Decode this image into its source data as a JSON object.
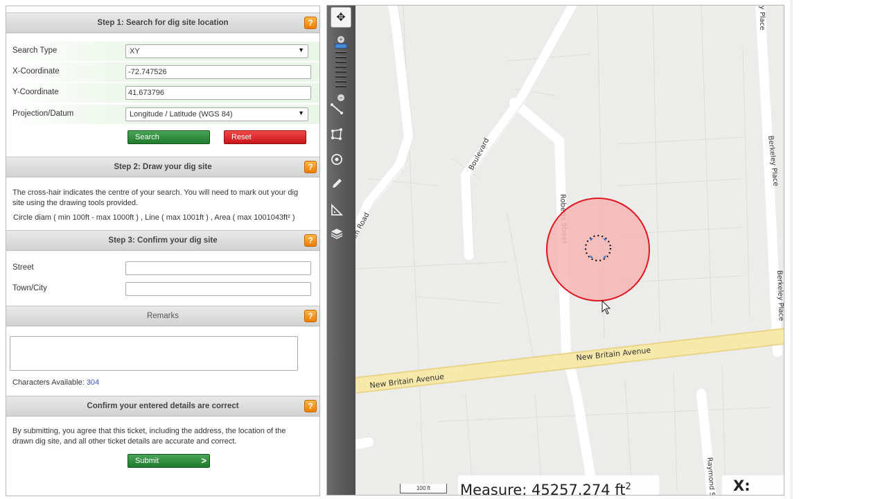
{
  "form": {
    "step1": {
      "title": "Step 1: Search for dig site location",
      "help": "?",
      "fields": [
        {
          "label": "Search Type",
          "value": "XY",
          "kind": "select"
        },
        {
          "label": "X-Coordinate",
          "value": "-72.747526",
          "kind": "input"
        },
        {
          "label": "Y-Coordinate",
          "value": "41.673796",
          "kind": "input"
        },
        {
          "label": "Projection/Datum",
          "value": "Longitude / Latitude (WGS 84)",
          "kind": "select"
        }
      ],
      "search_label": "Search",
      "reset_label": "Reset"
    },
    "step2": {
      "title": "Step 2: Draw your dig site",
      "help": "?",
      "instructions_line1": "The cross-hair indicates the centre of your search. You will need to mark out your dig",
      "instructions_line2": "site using the drawing tools provided.",
      "limits": "Circle diam ( min 100ft - max 1000ft ) , Line ( max 1001ft ) , Area ( max 1001043ft² )"
    },
    "step3": {
      "title": "Step 3: Confirm your dig site",
      "help": "?",
      "street_label": "Street",
      "street_value": "",
      "town_label": "Town/City",
      "town_value": ""
    },
    "remarks": {
      "title": "Remarks",
      "help": "?",
      "value": "",
      "chars_label": "Characters Available:",
      "chars_count": "304"
    },
    "confirm": {
      "title": "Confirm your entered details are correct",
      "help": "?",
      "text_line1": "By submitting, you agree that this ticket, including the address, the location of the",
      "text_line2": "drawn dig site, and all other ticket details are accurate and correct.",
      "submit_label": "Submit",
      "submit_arrow": ">"
    }
  },
  "map": {
    "streets": {
      "new_britain_1": "New Britain Avenue",
      "new_britain_2": "New Britain Avenue",
      "roberts": "Roberts Street",
      "boulevard": "Boulevard",
      "berkeley_1": "Berkeley Place",
      "berkeley_2": "Berkeley Place",
      "berkeley_top": "y Place",
      "raymond": "Raymond S",
      "ham_road": "hm Road"
    },
    "measure_label": "Measure: 45257.274 ft",
    "measure_unit_power": "2",
    "coord_label": "X:",
    "scale_label": "100 ft",
    "colors": {
      "road_major": "#f5e6a3",
      "road_minor": "#ffffff",
      "land": "#ececea",
      "dig_circle_fill": "#f8b8b8",
      "dig_circle_stroke": "#e0141e"
    },
    "tools": [
      "pan-icon",
      "zoom-in-icon",
      "zoom-out-icon",
      "line-tool-icon",
      "polygon-tool-icon",
      "circle-tool-icon",
      "pencil-icon",
      "measure-icon",
      "layers-icon"
    ]
  }
}
